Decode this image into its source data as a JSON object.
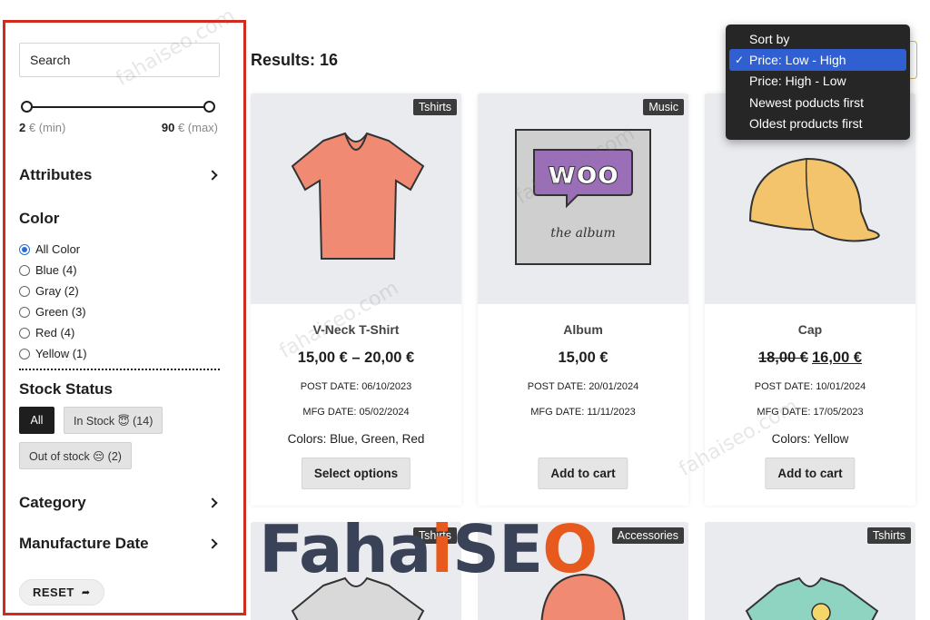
{
  "sidebar": {
    "search_placeholder": "Search",
    "price": {
      "min_value": "2",
      "min_suffix": " € (min)",
      "max_value": "90",
      "max_suffix": " € (max)"
    },
    "sections": {
      "attributes": "Attributes",
      "color": "Color",
      "stock_status": "Stock Status",
      "category": "Category",
      "manufacture_date": "Manufacture Date"
    },
    "colors": [
      {
        "label": "All Color",
        "checked": true
      },
      {
        "label": "Blue (4)",
        "checked": false
      },
      {
        "label": "Gray (2)",
        "checked": false
      },
      {
        "label": "Green (3)",
        "checked": false
      },
      {
        "label": "Red (4)",
        "checked": false
      },
      {
        "label": "Yellow (1)",
        "checked": false
      }
    ],
    "stock": {
      "all": "All",
      "in_stock": "In Stock 😇 (14)",
      "out_of_stock": "Out of stock 😔 (2)"
    },
    "reset_label": "RESET",
    "reset_arrow": "➦"
  },
  "main": {
    "results": "Results: 16",
    "sort": {
      "options": [
        "Sort by",
        "Price: Low - High",
        "Price: High - Low",
        "Newest poducts first",
        "Oldest products first"
      ],
      "selected_index": 1,
      "check": "✓"
    },
    "products": [
      {
        "tag": "Tshirts",
        "name": "V-Neck T-Shirt",
        "price": "15,00 € – 20,00 €",
        "price_old": "",
        "post_date": "POST DATE: 06/10/2023",
        "mfg_date": "MFG DATE: 05/02/2024",
        "colors": "Colors: Blue, Green, Red",
        "button": "Select options"
      },
      {
        "tag": "Music",
        "name": "Album",
        "price": "15,00 €",
        "price_old": "",
        "post_date": "POST DATE: 20/01/2024",
        "mfg_date": "MFG DATE: 11/11/2023",
        "colors": "",
        "button": "Add to cart"
      },
      {
        "tag": "",
        "name": "Cap",
        "price": "16,00 €",
        "price_old": "18,00 €",
        "post_date": "POST DATE: 10/01/2024",
        "mfg_date": "MFG DATE: 17/05/2023",
        "colors": "Colors: Yellow",
        "button": "Add to cart"
      }
    ],
    "second_row_tags": [
      "Tshirts",
      "Accessories",
      "Tshirts"
    ]
  },
  "watermark": {
    "brand_a": "Faha",
    "brand_b": "i",
    "brand_c": "SE",
    "brand_d": "O",
    "site": "fahaiseo.com"
  },
  "colors": {
    "accent_border": "#d32a1f",
    "radio_blue": "#2b6cd6",
    "dropdown_bg": "#262626",
    "dropdown_sel": "#2f5fd1",
    "brand_navy": "#3a4258",
    "brand_orange": "#e8591e"
  }
}
